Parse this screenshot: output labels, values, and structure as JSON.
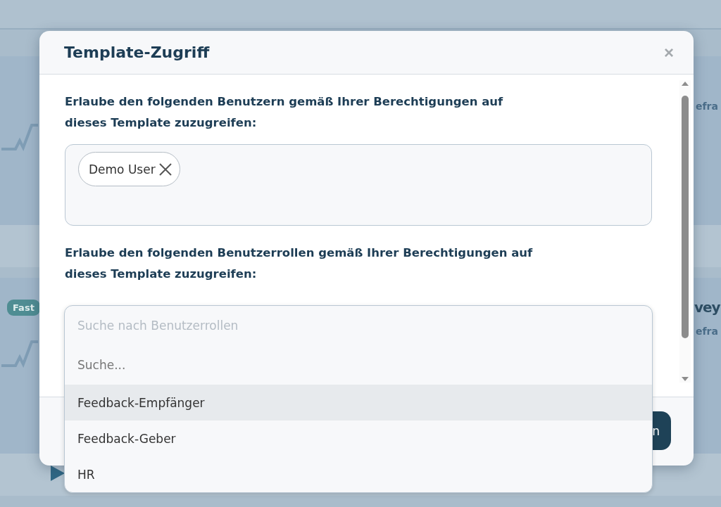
{
  "background": {
    "badge": "Fast",
    "texts": [
      {
        "kind": "sub",
        "text": "efra"
      },
      {
        "kind": "title",
        "text": "vey"
      },
      {
        "kind": "sub",
        "text": "efra"
      }
    ],
    "button": "n"
  },
  "dialog": {
    "title": "Template-Zugriff",
    "close": "×",
    "users_label": "Erlaube den folgenden Benutzern gemäß Ihrer Berechtigungen auf dieses Template zuzugreifen:",
    "users": [
      {
        "name": "Demo User"
      }
    ],
    "roles_label": "Erlaube den folgenden Benutzerrollen gemäß Ihrer Berechtigungen auf dieses Template zuzugreifen:",
    "roles_field": {
      "placeholder": "Suche nach Benutzerrollen"
    },
    "dropdown": {
      "search_placeholder": "Suche...",
      "options": [
        {
          "label": "Feedback-Empfänger",
          "selected": true
        },
        {
          "label": "Feedback-Geber",
          "selected": false
        },
        {
          "label": "HR",
          "selected": false
        }
      ]
    }
  }
}
